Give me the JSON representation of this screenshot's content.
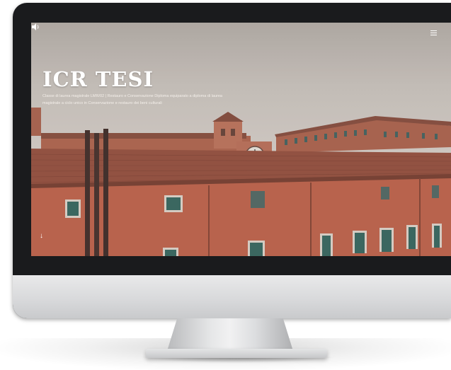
{
  "hero": {
    "title": "ICR TESI",
    "subtitle_line1": "Classe di laurea magistrale LMR/02 | Restauro e Conservazione Diploma equiparato a diploma di laurea",
    "subtitle_line2": "magistrale a ciclo unico in Conservazione e restauro dei beni culturali"
  },
  "icons": {
    "menu": "hamburger-menu-icon",
    "scroll": "arrow-down-icon",
    "sound": "speaker-icon"
  },
  "colors": {
    "bezel": "#1a1b1d",
    "wall": "#c46a52",
    "roof": "#9e5a48",
    "shutter": "#3f6e66",
    "sky": "#d4cdc6",
    "title": "#ffffff"
  }
}
